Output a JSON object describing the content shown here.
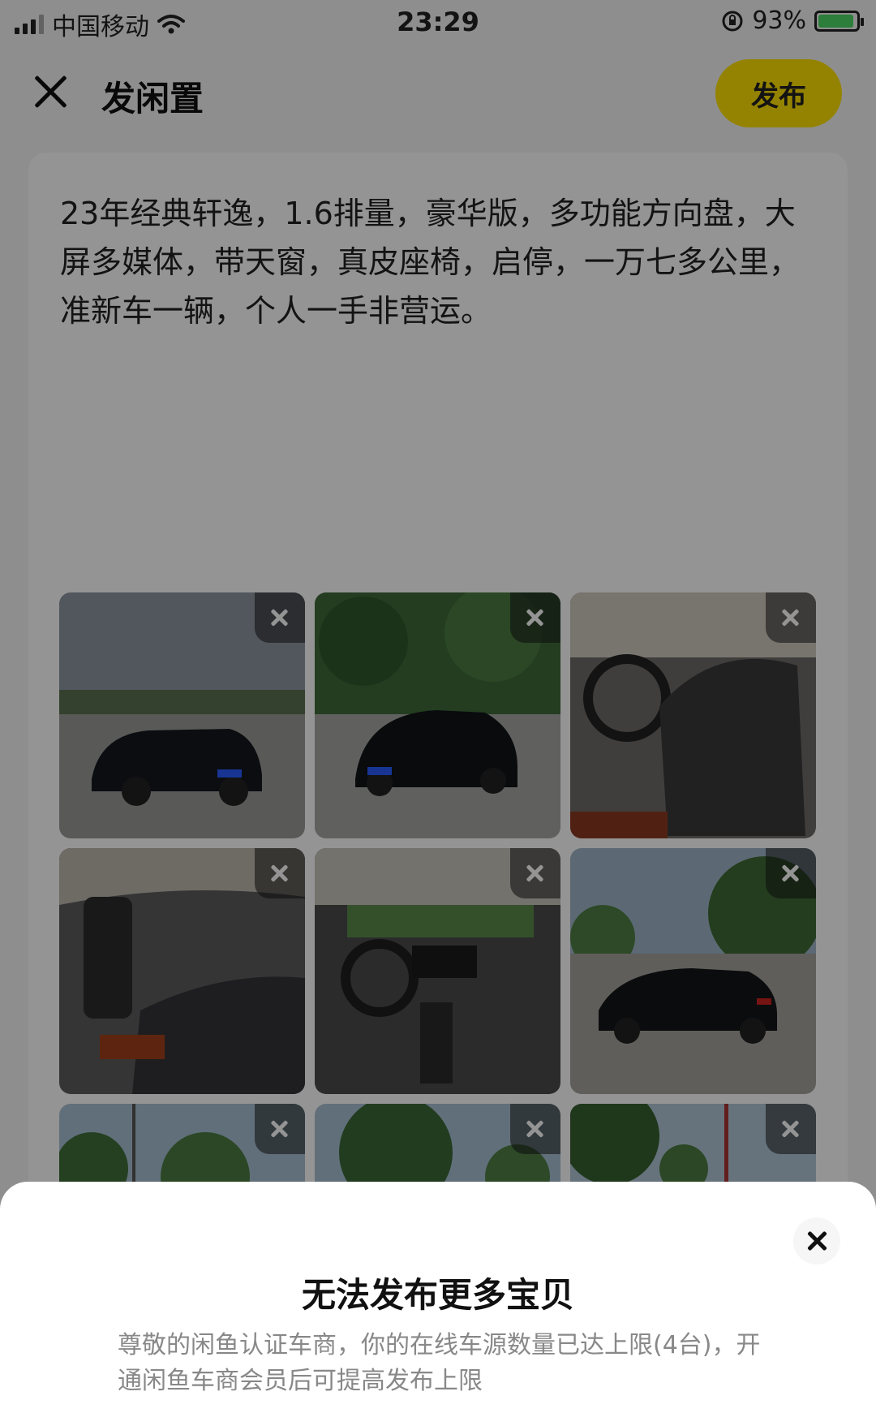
{
  "status_bar": {
    "carrier": "中国移动",
    "time": "23:29",
    "battery_percent": "93%",
    "battery_level": 0.93
  },
  "header": {
    "title": "发闲置",
    "publish_label": "发布"
  },
  "post": {
    "description": "23年经典轩逸，1.6排量，豪华版，多功能方向盘，大屏多媒体，带天窗，真皮座椅，启停，一万七多公里，准新车一辆，个人一手非营运。",
    "photos": [
      {
        "subject": "car-front-left"
      },
      {
        "subject": "car-front"
      },
      {
        "subject": "driver-seat"
      },
      {
        "subject": "rear-seats"
      },
      {
        "subject": "dashboard"
      },
      {
        "subject": "car-rear"
      },
      {
        "subject": "trees-outdoor"
      },
      {
        "subject": "trees-outdoor"
      },
      {
        "subject": "trees-outdoor"
      }
    ]
  },
  "modal": {
    "title": "无法发布更多宝贝",
    "message": "尊敬的闲鱼认证车商，你的在线车源数量已达上限(4台)，开通闲鱼车商会员后可提高发布上限"
  },
  "colors": {
    "accent": "#ffe200",
    "overlay": "rgba(0,0,0,0.42)"
  }
}
